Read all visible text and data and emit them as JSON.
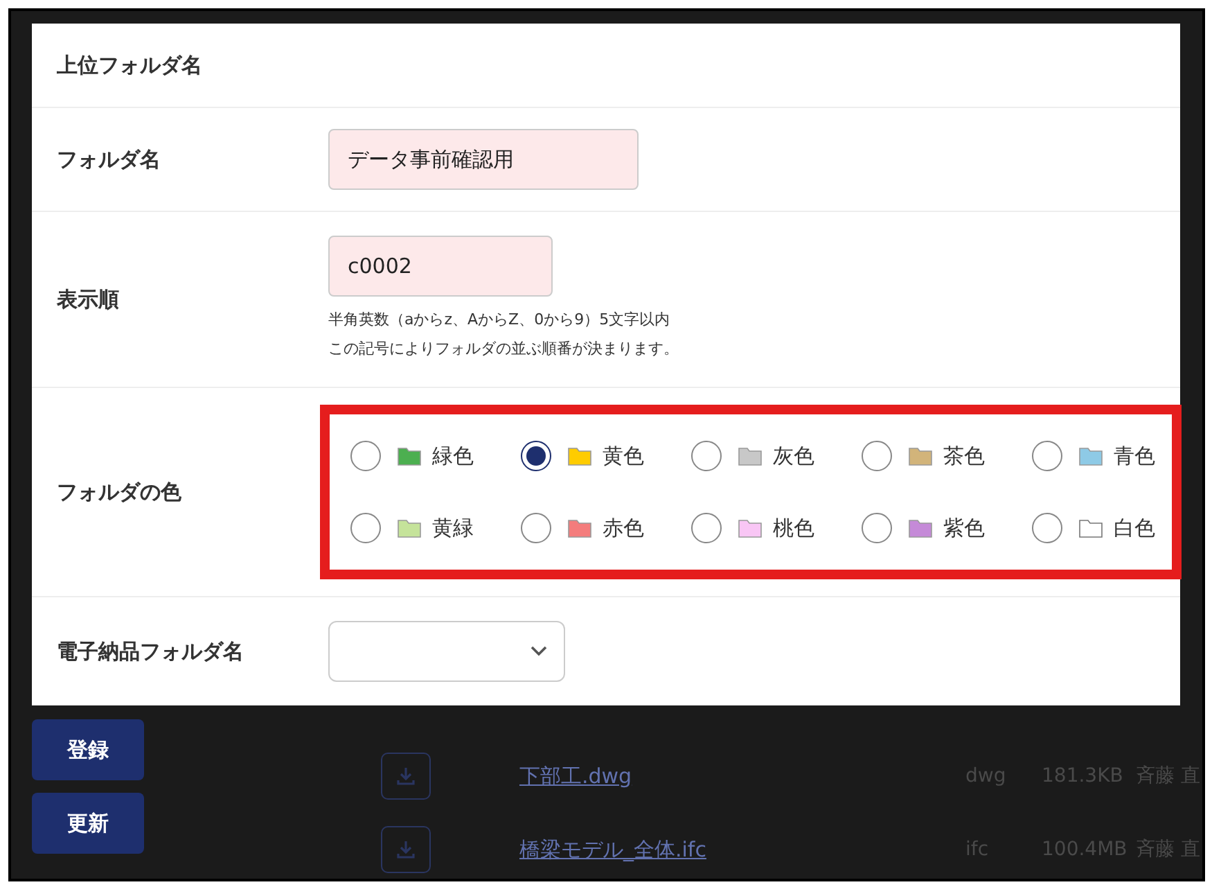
{
  "modal": {
    "title": "上位フォルダ名",
    "fields": [
      {
        "kind": "text",
        "label": "フォルダ名",
        "value": "データ事前確認用"
      },
      {
        "kind": "text",
        "label": "表示順",
        "value": "c0002",
        "hints": [
          "半角英数（aからz、AからZ、0から9）5文字以内",
          "この記号によりフォルダの並ぶ順番が決まります。"
        ]
      },
      {
        "kind": "colors",
        "label": "フォルダの色",
        "options": [
          {
            "label": "緑色",
            "color": "#4caf50",
            "selected": false
          },
          {
            "label": "黄色",
            "color": "#ffcc00",
            "selected": true
          },
          {
            "label": "灰色",
            "color": "#c8c8c8",
            "selected": false
          },
          {
            "label": "茶色",
            "color": "#d2b47a",
            "selected": false
          },
          {
            "label": "青色",
            "color": "#8ecae6",
            "selected": false
          },
          {
            "label": "黄緑",
            "color": "#c5e39a",
            "selected": false
          },
          {
            "label": "赤色",
            "color": "#f47c7c",
            "selected": false
          },
          {
            "label": "桃色",
            "color": "#f9c6f5",
            "selected": false
          },
          {
            "label": "紫色",
            "color": "#c58ad8",
            "selected": false
          },
          {
            "label": "白色",
            "color": "#ffffff",
            "selected": false
          }
        ]
      },
      {
        "kind": "select",
        "label": "電子納品フォルダ名"
      }
    ]
  },
  "buttons": [
    "登録",
    "更新"
  ],
  "files": [
    {
      "name": "下部工.dwg",
      "type": "dwg",
      "size": "181.3KB",
      "owner": "斉藤 直"
    },
    {
      "name": "橋梁モデル_全体.ifc",
      "type": "ifc",
      "size": "100.4MB",
      "owner": "斉藤 直"
    }
  ]
}
